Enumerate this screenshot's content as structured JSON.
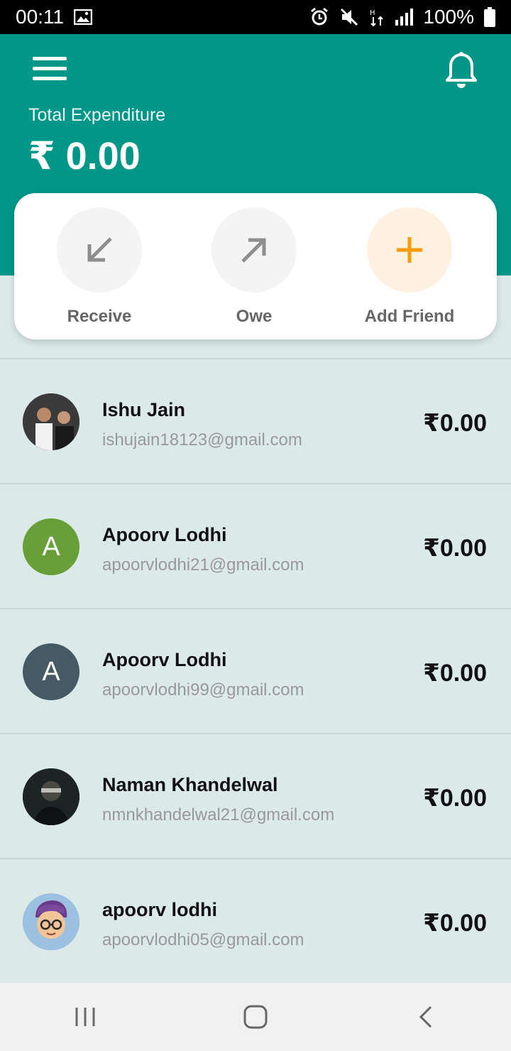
{
  "status": {
    "time": "00:11",
    "battery": "100%"
  },
  "header": {
    "total_label": "Total Expenditure",
    "total_value": "₹ 0.00",
    "bg_color": "#009688"
  },
  "actions": [
    {
      "label": "Receive",
      "icon": "arrow-down-left-icon"
    },
    {
      "label": "Owe",
      "icon": "arrow-up-right-icon"
    },
    {
      "label": "Add Friend",
      "icon": "plus-icon"
    }
  ],
  "friends": [
    {
      "name": "Ishu Jain",
      "email": "ishujain18123@gmail.com",
      "amount": "₹0.00",
      "avatar": "photo"
    },
    {
      "name": "Apoorv Lodhi",
      "email": "apoorvlodhi21@gmail.com",
      "amount": "₹0.00",
      "avatar": "A",
      "avatar_color": "#689f38"
    },
    {
      "name": "Apoorv Lodhi",
      "email": "apoorvlodhi99@gmail.com",
      "amount": "₹0.00",
      "avatar": "A",
      "avatar_color": "#455a64"
    },
    {
      "name": "Naman Khandelwal",
      "email": "nmnkhandelwal21@gmail.com",
      "amount": "₹0.00",
      "avatar": "photo"
    },
    {
      "name": "apoorv lodhi",
      "email": "apoorvlodhi05@gmail.com",
      "amount": "₹0.00",
      "avatar": "cartoon"
    }
  ]
}
